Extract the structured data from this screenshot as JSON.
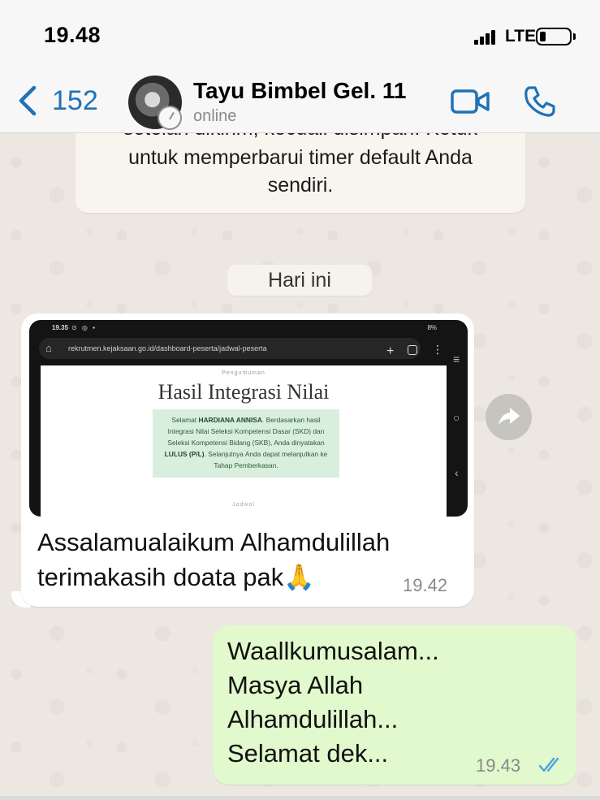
{
  "status_bar": {
    "time": "19.48",
    "network": "LTE"
  },
  "header": {
    "back_count": "152",
    "contact_name": "Tayu Bimbel Gel. 11",
    "contact_status": "online",
    "icons": [
      "chevron-left-icon",
      "video-call-icon",
      "phone-icon"
    ]
  },
  "system_message": {
    "line1": "setelah dikirim, kecuali disimpan. Ketuk",
    "line2": "untuk memperbarui timer default Anda",
    "line3": "sendiri."
  },
  "date_chip": "Hari ini",
  "incoming_message": {
    "screenshot": {
      "status_time": "19.35",
      "status_icons": "⊙ ◎ ▪",
      "battery": "8%",
      "url": "rekrutmen.kejaksaan.go.id/dashboard-peserta/jadwal-peserta",
      "announcement_label": "Pengumuman",
      "heading": "Hasil Integrasi Nilai",
      "body_intro": "Selamat",
      "name": "HARDIANA ANNISA",
      "body_mid": ". Berdasarkan hasil Integrasi Nilai Seleksi Kompetensi Dasar (SKD) dan Seleksi Kompetensi Bidang (SKB), Anda dinyatakan",
      "result": "LULUS (P/L)",
      "body_end": ". Selanjutnya Anda dapat melanjutkan ke Tahap Pemberkasan.",
      "footer_label": "Jadwal"
    },
    "text_line1": "Assalamualaikum Alhamdulillah",
    "text_line2": "terimakasih doata pak🙏",
    "time": "19.42"
  },
  "outgoing_message": {
    "lines": [
      "Waallkumusalam...",
      "Masya Allah",
      "Alhamdulillah...",
      "Selamat dek..."
    ],
    "time": "19.43",
    "status": "read"
  },
  "colors": {
    "accent_blue": "#1f72b8",
    "outgoing_bubble": "#e1f9cc",
    "incoming_bubble": "#ffffff",
    "read_ticks": "#4fa3e0"
  }
}
